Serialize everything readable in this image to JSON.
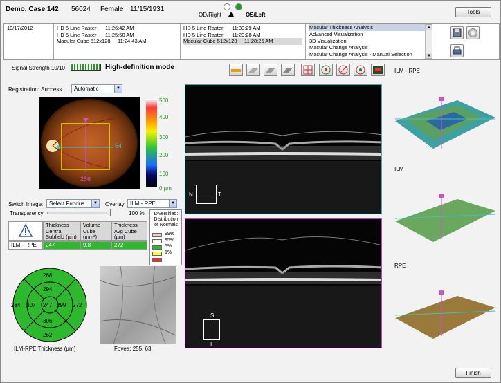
{
  "header": {
    "title": "Demo, Case 142",
    "patient_id": "56024",
    "gender": "Female",
    "dob": "11/15/1931",
    "eye_right": "OD/Right",
    "eye_left": "OS/Left",
    "tools_label": "Tools",
    "finish_label": "Finish"
  },
  "scans": {
    "date": "10/17/2012",
    "col1": [
      {
        "name": "HD 5 Line Raster",
        "time": "11:26:42 AM"
      },
      {
        "name": "HD 5 Line Raster",
        "time": "11:25:50 AM"
      },
      {
        "name": "Macular Cube 512x128",
        "time": "11:24:43 AM"
      }
    ],
    "col2": [
      {
        "name": "HD 5 Line Raster",
        "time": "11:30:29 AM"
      },
      {
        "name": "HD 5 Line Raster",
        "time": "11:29:28 AM"
      },
      {
        "name": "Macular Cube 512x128",
        "time": "11:28:25 AM"
      }
    ],
    "analysis": [
      "Macular Thickness Analysis",
      "Advanced Visualization",
      "3D Visualization",
      "Macular Change Analysis",
      "Macular Change Analysis - Manual Selection"
    ]
  },
  "status": {
    "signal_label": "Signal Strength",
    "signal_value": "10/10",
    "hd_mode": "High-definition mode",
    "registration": "Registration: Success",
    "registration_mode": "Automatic"
  },
  "fundus": {
    "right_value": "64",
    "bottom_value": "256",
    "scale": [
      "500",
      "400",
      "300",
      "200",
      "100",
      "0 µm"
    ]
  },
  "controls": {
    "switch_image_label": "Switch Image:",
    "switch_image_value": "Select Fundus",
    "overlay_label": "Overlay",
    "overlay_value": "ILM - RPE",
    "transparency_label": "Transparency",
    "transparency_value": "100 %"
  },
  "table": {
    "headers": [
      "Thickness Central Subfield (µm)",
      "Volume Cube (mm³)",
      "Thickness Avg Cube (µm)"
    ],
    "row_label": "ILM - RPE",
    "values": [
      "247",
      "9.8",
      "272"
    ]
  },
  "distribution": {
    "title": "Diversified: Distribution of Normals",
    "items": [
      {
        "label": "99%",
        "color": "#ffcccc"
      },
      {
        "label": "95%",
        "color": "#ffffff"
      },
      {
        "label": "5%",
        "color": "#2eb82e"
      },
      {
        "label": "1%",
        "color": "#ffff33"
      },
      {
        "label": "",
        "color": "#ff2a2a"
      }
    ]
  },
  "etdrs": {
    "center": "247",
    "inner": {
      "top": "294",
      "left": "307",
      "right": "299",
      "bottom": "306"
    },
    "outer": {
      "top": "268",
      "left": "284",
      "right": "272",
      "bottom": "262"
    },
    "caption": "ILM-RPE Thickness (µm)"
  },
  "fovea": {
    "label": "Fovea:",
    "value": "255, 63"
  },
  "oct": {
    "top_left": "N",
    "top_right": "T",
    "bottom_top": "S",
    "bottom_bottom": "I"
  },
  "three_d": {
    "labels": [
      "ILM - RPE",
      "ILM",
      "RPE"
    ]
  }
}
